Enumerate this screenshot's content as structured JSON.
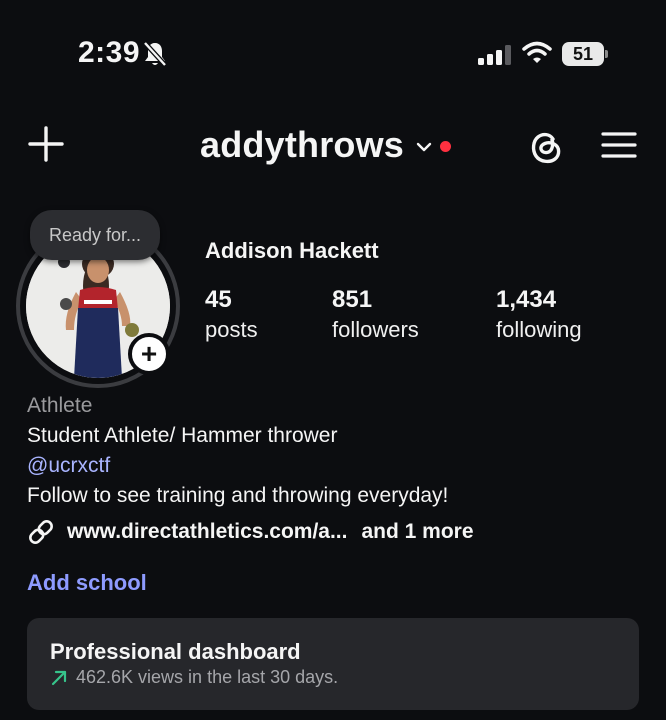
{
  "status_bar": {
    "time": "2:39",
    "battery": "51"
  },
  "header": {
    "username": "addythrows"
  },
  "profile": {
    "note": "Ready for...",
    "full_name": "Addison Hackett",
    "stats": [
      {
        "value": "45",
        "label": "posts"
      },
      {
        "value": "851",
        "label": "followers"
      },
      {
        "value": "1,434",
        "label": "following"
      }
    ]
  },
  "bio": {
    "category": "Athlete",
    "line1": "Student Athlete/ Hammer thrower",
    "mention": "@ucrxctf",
    "line2": "Follow to see training and throwing everyday!",
    "link": "www.directathletics.com/a...",
    "link_more": "and 1 more",
    "add_school": "Add school"
  },
  "dashboard": {
    "title": "Professional dashboard",
    "stat": "462.6K views in the last 30 days."
  },
  "colors": {
    "background": "#0c0d10",
    "accent_link": "#8e9bff",
    "mention": "#a9b4ff",
    "notification_dot": "#ff3040",
    "card": "#26272b",
    "trend_up": "#36c48b"
  },
  "icons": [
    "bell-slash-icon",
    "signal-icon",
    "wifi-icon",
    "battery-icon",
    "plus-icon",
    "chevron-down-icon",
    "threads-icon",
    "menu-icon",
    "link-icon",
    "trend-up-icon"
  ]
}
